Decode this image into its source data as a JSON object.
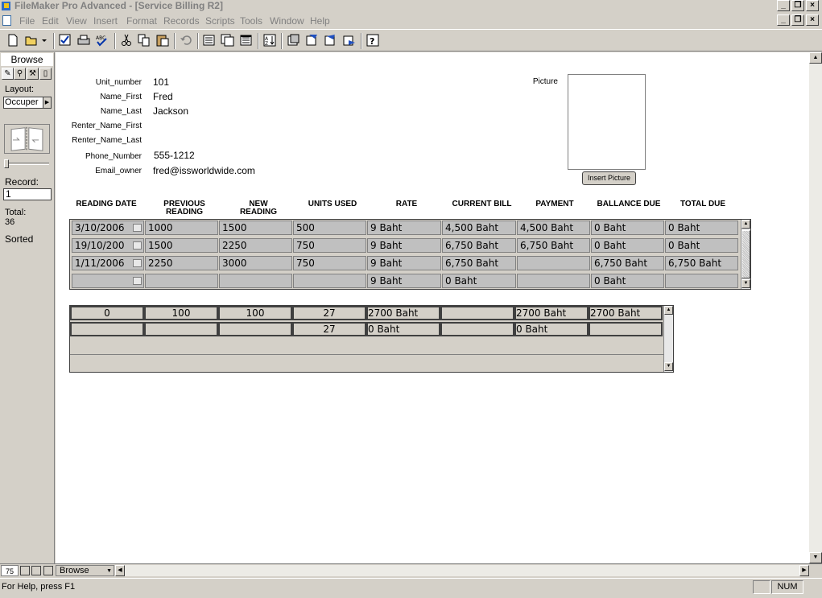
{
  "window": {
    "title": "FileMaker Pro Advanced - [Service Billing R2]"
  },
  "menu": [
    "File",
    "Edit",
    "View",
    "Insert",
    "Format",
    "Records",
    "Scripts",
    "Tools",
    "Window",
    "Help"
  ],
  "status_area": {
    "mode": "Browse",
    "layout_label": "Layout:",
    "layout_value": "Occuper",
    "record_label": "Record:",
    "record_value": "1",
    "total_label": "Total:",
    "total_value": "36",
    "sorted_label": "Sorted"
  },
  "fields": [
    {
      "label": "Unit_number",
      "value": "101"
    },
    {
      "label": "Name_First",
      "value": "Fred"
    },
    {
      "label": "Name_Last",
      "value": "Jackson"
    },
    {
      "label": "Renter_Name_First",
      "value": ""
    },
    {
      "label": "Renter_Name_Last",
      "value": ""
    },
    {
      "label": "Phone_Number",
      "value": "555-1212"
    },
    {
      "label": "Email_owner",
      "value": "fred@issworldwide.com"
    }
  ],
  "picture": {
    "label": "Picture",
    "button": "Insert Picture"
  },
  "portal": {
    "columns": [
      {
        "line1": "",
        "line2": "READING DATE"
      },
      {
        "line1": "PREVIOUS",
        "line2": "READING"
      },
      {
        "line1": "NEW",
        "line2": "READING"
      },
      {
        "line1": "",
        "line2": "UNITS USED"
      },
      {
        "line1": "",
        "line2": "RATE"
      },
      {
        "line1": "",
        "line2": "CURRENT BILL"
      },
      {
        "line1": "",
        "line2": "PAYMENT"
      },
      {
        "line1": "",
        "line2": "BALLANCE DUE"
      },
      {
        "line1": "",
        "line2": "TOTAL DUE"
      }
    ],
    "rows": [
      [
        "3/10/2006",
        "1000",
        "1500",
        "500",
        "9 Baht",
        "4,500 Baht",
        "4,500 Baht",
        "0 Baht",
        "0 Baht"
      ],
      [
        "19/10/200",
        "1500",
        "2250",
        "750",
        "9 Baht",
        "6,750 Baht",
        "6,750 Baht",
        "0 Baht",
        "0 Baht"
      ],
      [
        "1/11/2006",
        "2250",
        "3000",
        "750",
        "9 Baht",
        "6,750 Baht",
        "",
        "6,750 Baht",
        "6,750 Baht"
      ],
      [
        "",
        "",
        "",
        "",
        "9 Baht",
        "0 Baht",
        "",
        "0 Baht",
        ""
      ]
    ]
  },
  "summary": {
    "rows": [
      [
        "0",
        "100",
        "100",
        "27",
        "2700 Baht",
        "",
        "2700 Baht",
        "2700 Baht"
      ],
      [
        "",
        "",
        "",
        "27",
        "0 Baht",
        "",
        "0 Baht",
        ""
      ]
    ]
  },
  "bottom_bar": {
    "zoom": "75",
    "mode": "Browse"
  },
  "statusbar": {
    "help": "For Help, press F1",
    "num": "NUM"
  }
}
